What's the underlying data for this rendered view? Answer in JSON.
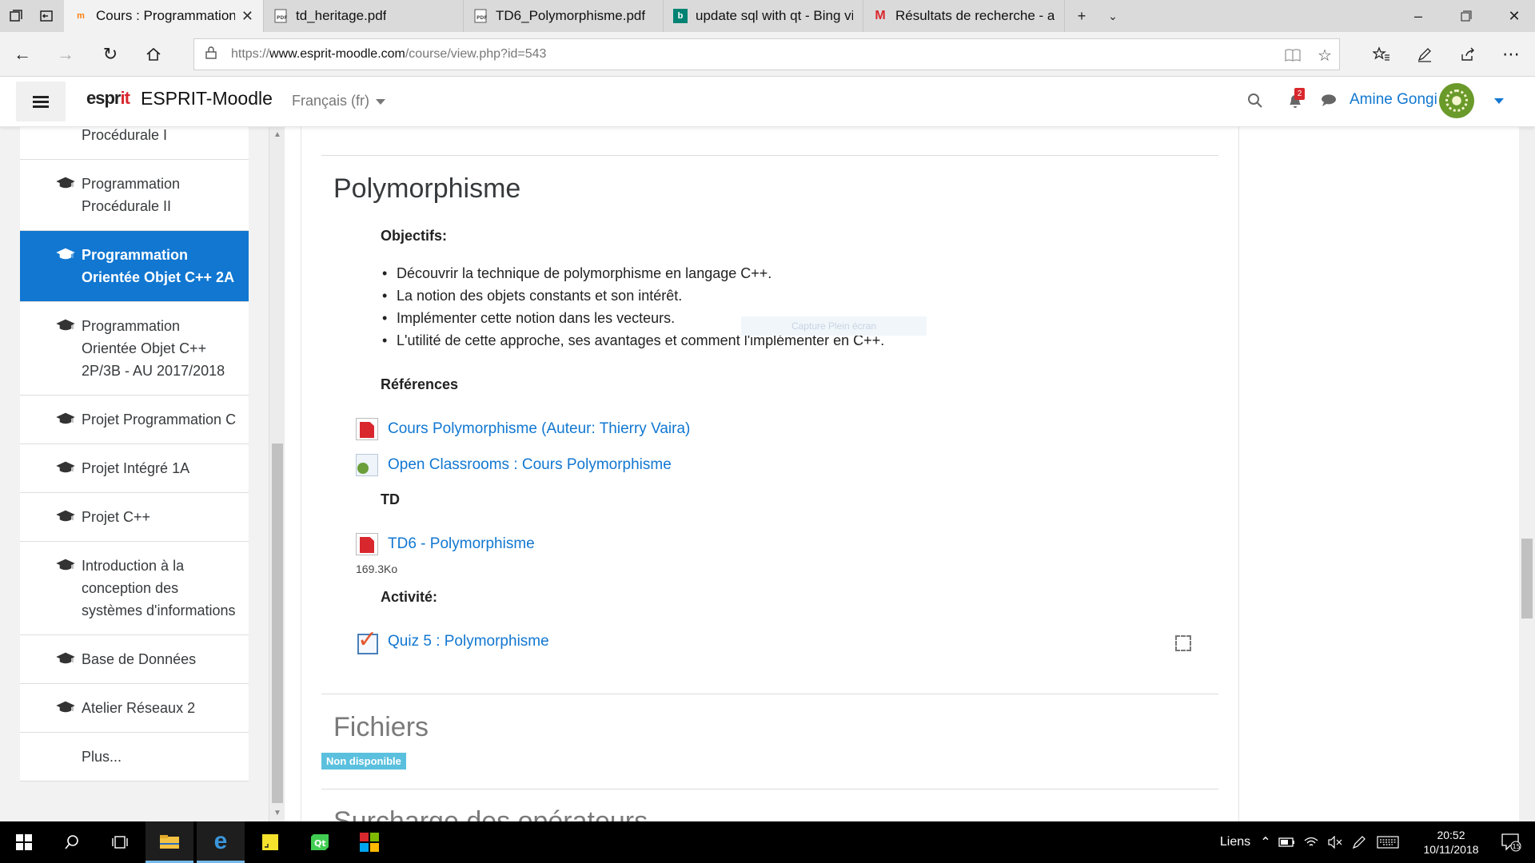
{
  "browser": {
    "tabs": [
      {
        "label": "Cours : Programmation",
        "favicon": "moodle-icon",
        "active": true
      },
      {
        "label": "td_heritage.pdf",
        "favicon": "pdf-icon",
        "active": false
      },
      {
        "label": "TD6_Polymorphisme.pdf",
        "favicon": "pdf-icon",
        "active": false
      },
      {
        "label": "update sql with qt - Bing vid",
        "favicon": "bing-icon",
        "active": false
      },
      {
        "label": "Résultats de recherche - am",
        "favicon": "gmail-icon",
        "active": false
      }
    ],
    "url": {
      "protocol": "https://",
      "domain": "www.esprit-moodle.com",
      "path": "/course/view.php?id=543"
    }
  },
  "header": {
    "logo_a": "espr",
    "logo_b": "it",
    "site_name": "ESPRIT-Moodle",
    "language": "Français (fr)",
    "notifications_count": "2",
    "user_name": "Amine Gongi"
  },
  "drawer": {
    "items": [
      {
        "label": "Procédurale I",
        "active": false
      },
      {
        "label": "Programmation Procédurale II",
        "active": false
      },
      {
        "label": "Programmation Orientée Objet C++ 2A",
        "active": true
      },
      {
        "label": "Programmation Orientée Objet C++ 2P/3B - AU 2017/2018",
        "active": false
      },
      {
        "label": "Projet Programmation C",
        "active": false
      },
      {
        "label": "Projet Intégré 1A",
        "active": false
      },
      {
        "label": "Projet C++",
        "active": false
      },
      {
        "label": "Introduction à la conception des systèmes d'informations",
        "active": false
      },
      {
        "label": "Base de Données",
        "active": false
      },
      {
        "label": "Atelier Réseaux 2",
        "active": false
      },
      {
        "label": "Plus...",
        "active": false
      }
    ]
  },
  "section": {
    "title": "Polymorphisme",
    "objectives_heading": "Objectifs:",
    "objectives": [
      "Découvrir la technique de polymorphisme en langage C++.",
      " La notion des objets constants et son intérêt.",
      "Implémenter cette notion dans les vecteurs.",
      "L'utilité de cette approche, ses avantages et comment l'implémenter en C++."
    ],
    "ghost_text": "Capture Plein écran",
    "references_heading": "Références",
    "resources": [
      {
        "label": "Cours Polymorphisme (Auteur: Thierry Vaira)",
        "icon": "pdf-icon"
      },
      {
        "label": "Open Classrooms : Cours Polymorphisme",
        "icon": "url-icon"
      }
    ],
    "td_heading": "TD",
    "td_resource": {
      "label": "TD6 - Polymorphisme",
      "icon": "pdf-icon",
      "size": "169.3Ko"
    },
    "activity_heading": "Activité:",
    "activity_resource": {
      "label": "Quiz 5 : Polymorphisme",
      "icon": "quiz-icon"
    }
  },
  "section2": {
    "title": "Fichiers",
    "badge": "Non disponible"
  },
  "section3": {
    "title": "Surcharge des opérateurs"
  },
  "taskbar": {
    "links_label": "Liens",
    "time": "20:52",
    "date": "10/11/2018",
    "notification_count": "15"
  },
  "colors": {
    "accent": "#1177d1",
    "badge_info": "#5bc0de",
    "notification": "#d9272e"
  }
}
